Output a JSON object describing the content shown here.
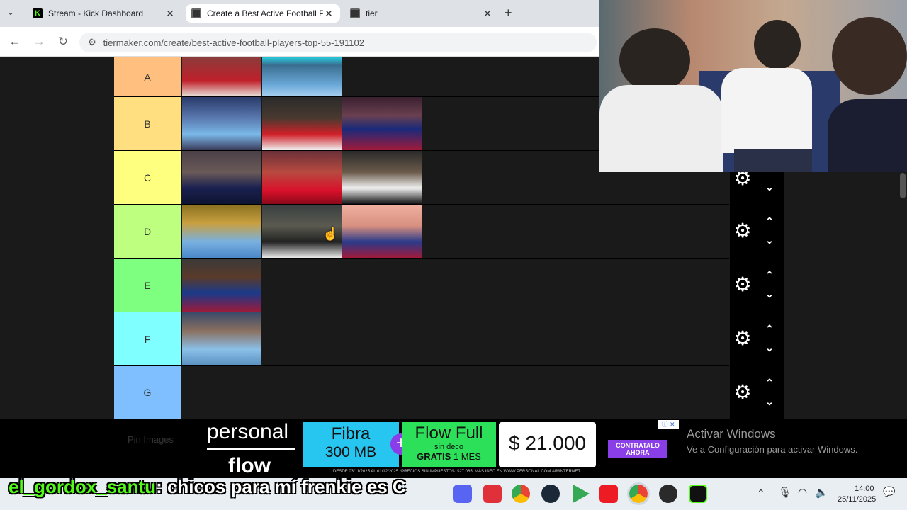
{
  "browser": {
    "tabs": [
      {
        "title": "Stream - Kick Dashboard",
        "icon": "kick-icon"
      },
      {
        "title": "Create a Best Active Football Pl",
        "icon": "tiermaker-icon"
      },
      {
        "title": "tier",
        "icon": "tiermaker-icon"
      }
    ],
    "url": "tiermaker.com/create/best-active-football-players-top-55-191102"
  },
  "tiers": [
    {
      "label": "A",
      "color": "#ffbf7f",
      "players": [
        "player-a1",
        "player-a2"
      ]
    },
    {
      "label": "B",
      "color": "#ffdf7f",
      "players": [
        "player-b1",
        "player-b2",
        "player-b3"
      ]
    },
    {
      "label": "C",
      "color": "#ffff7f",
      "players": [
        "player-c1",
        "player-c2",
        "player-c3"
      ]
    },
    {
      "label": "D",
      "color": "#bfff7f",
      "players": [
        "player-d1",
        "player-d2",
        "player-d3"
      ]
    },
    {
      "label": "E",
      "color": "#7fff7f",
      "players": [
        "player-e1"
      ]
    },
    {
      "label": "F",
      "color": "#7fffff",
      "players": [
        "player-f1"
      ]
    },
    {
      "label": "G",
      "color": "#7fbfff",
      "players": []
    }
  ],
  "ad": {
    "brand_line1": "personal",
    "brand_line2": "flow",
    "fibra_title": "Fibra",
    "fibra_speed": "300 MB",
    "flow_title": "Flow Full",
    "flow_sub": "sin deco",
    "flow_gratis": "GRATIS",
    "flow_mes": "1 MES",
    "price": "$ 21.000",
    "cta_line1": "CONTRATALO",
    "cta_line2": "AHORA",
    "fine_print": "DESDE 03/11/2025 AL 01/12/2025 *PRECIOS SIN IMPUESTOS: $27.065. MÁS INFO EN WWW.PERSONAL.COM.AR/INTERNET",
    "overlay_text": "Pin Images"
  },
  "windows_activation": {
    "title": "Activar Windows",
    "subtitle": "Ve a Configuración para activar Windows."
  },
  "chat": {
    "username": "el_gordox_santu",
    "separator": ":",
    "message": " chicos para mí frenkie es C"
  },
  "taskbar": {
    "time": "14:00",
    "date": "25/11/2025"
  },
  "colors": {
    "kick_green": "#53fc18",
    "tier_bg": "#1a1a1a",
    "ad_blue": "#26c6f0",
    "ad_green": "#2de05a",
    "ad_purple": "#8a3ee8"
  }
}
